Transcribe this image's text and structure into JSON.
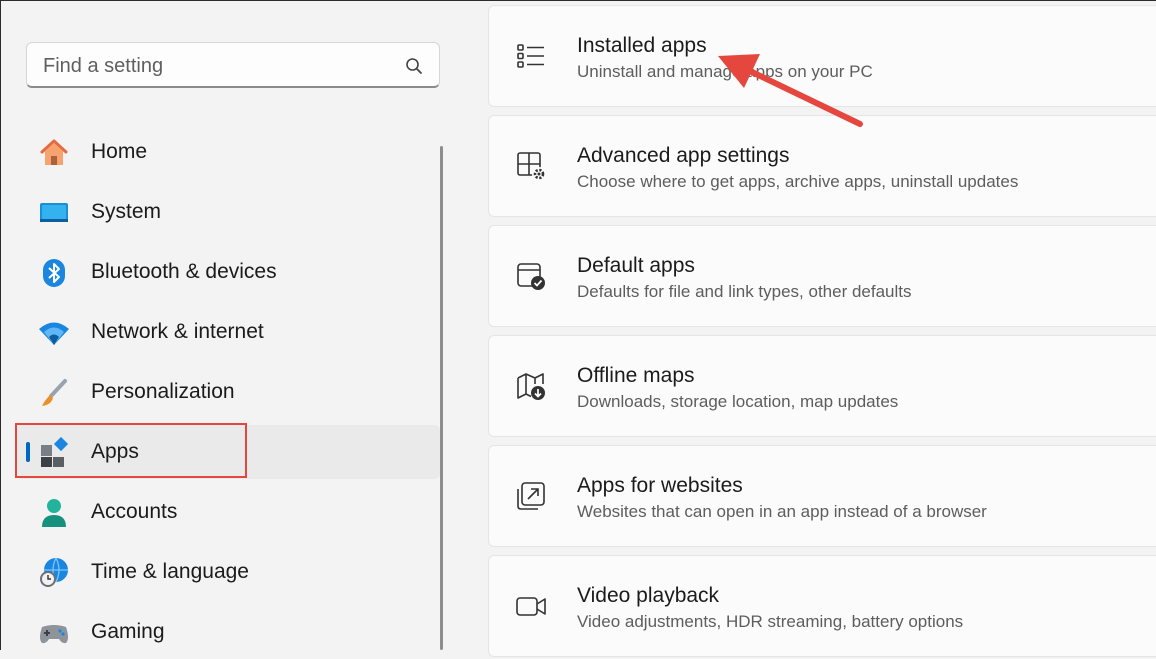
{
  "search": {
    "placeholder": "Find a setting",
    "icon": "search-icon"
  },
  "sidebar": {
    "items": [
      {
        "label": "Home",
        "icon": "home-icon"
      },
      {
        "label": "System",
        "icon": "system-icon"
      },
      {
        "label": "Bluetooth & devices",
        "icon": "bluetooth-icon"
      },
      {
        "label": "Network & internet",
        "icon": "wifi-icon"
      },
      {
        "label": "Personalization",
        "icon": "paintbrush-icon"
      },
      {
        "label": "Apps",
        "icon": "apps-icon",
        "selected": true
      },
      {
        "label": "Accounts",
        "icon": "accounts-icon"
      },
      {
        "label": "Time & language",
        "icon": "time-language-icon"
      },
      {
        "label": "Gaming",
        "icon": "gaming-icon"
      }
    ]
  },
  "main": {
    "cards": [
      {
        "title": "Installed apps",
        "subtitle": "Uninstall and manage apps on your PC",
        "icon": "list-icon"
      },
      {
        "title": "Advanced app settings",
        "subtitle": "Choose where to get apps, archive apps, uninstall updates",
        "icon": "app-settings-icon"
      },
      {
        "title": "Default apps",
        "subtitle": "Defaults for file and link types, other defaults",
        "icon": "default-apps-icon"
      },
      {
        "title": "Offline maps",
        "subtitle": "Downloads, storage location, map updates",
        "icon": "map-icon"
      },
      {
        "title": "Apps for websites",
        "subtitle": "Websites that can open in an app instead of a browser",
        "icon": "open-in-app-icon"
      },
      {
        "title": "Video playback",
        "subtitle": "Video adjustments, HDR streaming, battery options",
        "icon": "video-icon"
      }
    ]
  },
  "colors": {
    "accent": "#0067c0",
    "annotation": "#e5473f"
  }
}
